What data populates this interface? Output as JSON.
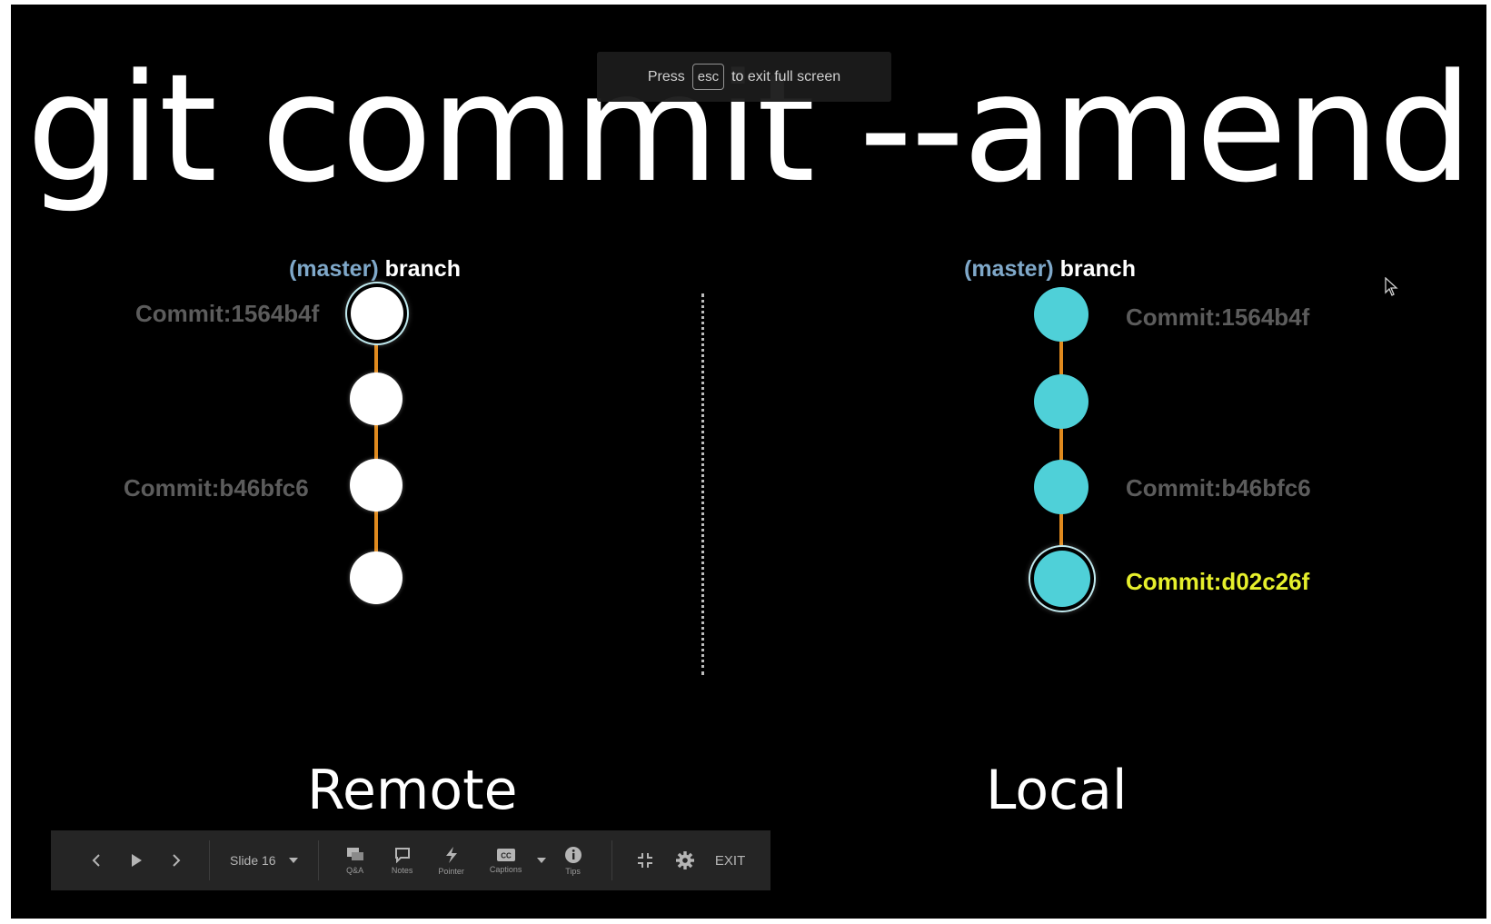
{
  "title": "git commit --amend",
  "fullscreen_notice": {
    "before": "Press",
    "key": "esc",
    "after": "to exit full screen"
  },
  "remote": {
    "branch_paren": "(master)",
    "branch_word": "branch",
    "side_label": "Remote",
    "commits": [
      "Commit:1564b4f",
      "Commit:b46bfc6"
    ]
  },
  "local": {
    "branch_paren": "(master)",
    "branch_word": "branch",
    "side_label": "Local",
    "commits": [
      "Commit:1564b4f",
      "Commit:b46bfc6",
      "Commit:d02c26f"
    ]
  },
  "colors": {
    "remote_node": "#ffffff",
    "local_node": "#4fd0d8",
    "edge": "#e08a1e",
    "highlight_label": "#e6ef2c",
    "muted_label": "#5c5c5c"
  },
  "toolbar": {
    "slide_label": "Slide 16",
    "qa": "Q&A",
    "notes": "Notes",
    "pointer": "Pointer",
    "captions": "Captions",
    "tips": "Tips",
    "exit": "EXIT",
    "icons": [
      "prev-icon",
      "play-icon",
      "next-icon",
      "chevron-down-icon",
      "chat-icon",
      "notes-icon",
      "pointer-icon",
      "captions-icon",
      "info-icon",
      "fullscreen-exit-icon",
      "gear-icon"
    ]
  }
}
